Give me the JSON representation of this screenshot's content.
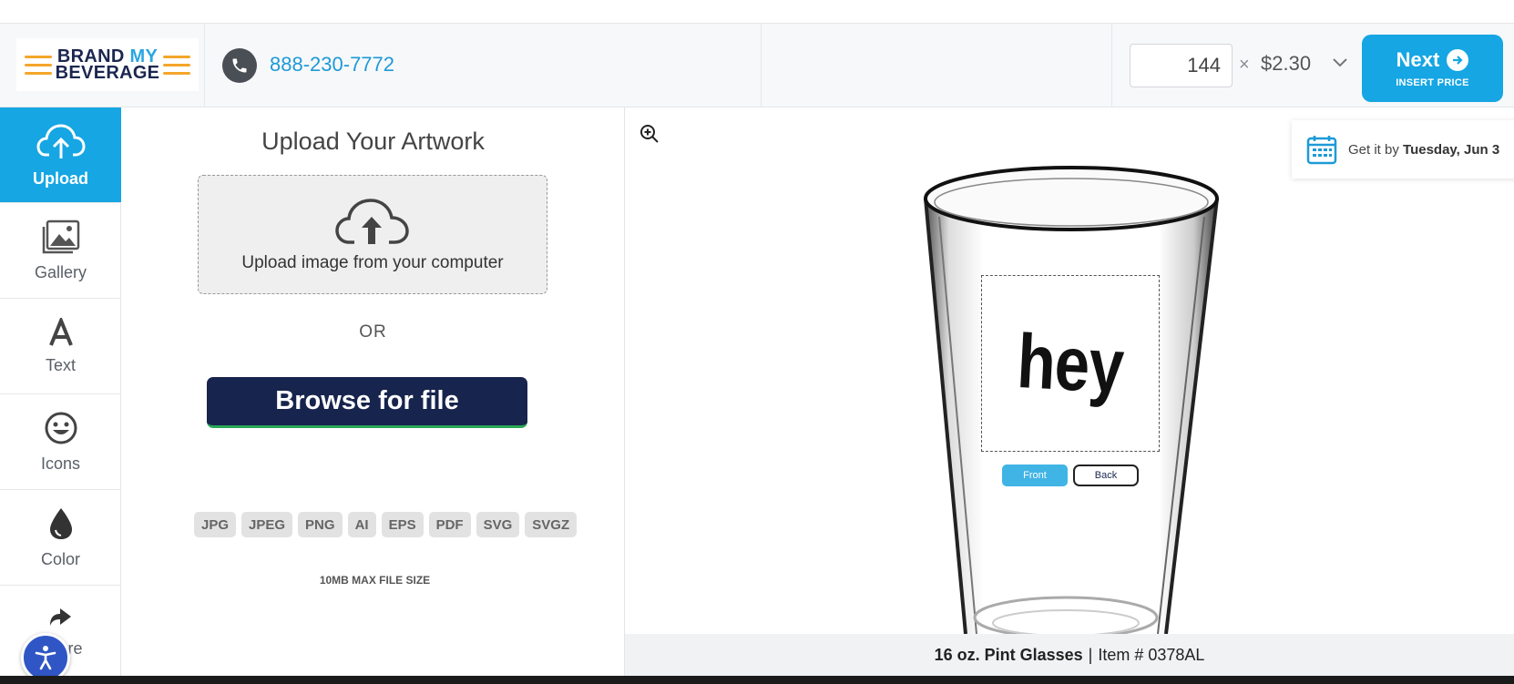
{
  "header": {
    "logo_line1": "BRAND",
    "logo_line1_accent": "MY",
    "logo_line2": "BEVERAGE",
    "phone": "888-230-7772",
    "quantity": "144",
    "times": "×",
    "unit_price": "$2.30",
    "next_label": "Next",
    "next_sub": "INSERT PRICE"
  },
  "sidebar": {
    "items": [
      {
        "label": "Upload",
        "icon": "cloud-upload-icon",
        "active": true
      },
      {
        "label": "Gallery",
        "icon": "gallery-icon"
      },
      {
        "label": "Text",
        "icon": "text-icon"
      },
      {
        "label": "Icons",
        "icon": "smiley-icon"
      },
      {
        "label": "Color",
        "icon": "droplet-icon"
      },
      {
        "label": "Share",
        "icon": "share-icon"
      }
    ]
  },
  "upload": {
    "title": "Upload Your Artwork",
    "drop_label": "Upload image from your computer",
    "or_text": "OR",
    "browse_label": "Browse for file",
    "formats": [
      "JPG",
      "JPEG",
      "PNG",
      "AI",
      "EPS",
      "PDF",
      "SVG",
      "SVGZ"
    ],
    "max_size": "10MB MAX FILE SIZE"
  },
  "preview": {
    "delivery_prefix": "Get it by",
    "delivery_date": "Tuesday, Jun 3",
    "print_text": "hey",
    "front_label": "Front",
    "back_label": "Back",
    "product_name": "16 oz. Pint Glasses",
    "item_sep": "|",
    "item_number": "Item # 0378AL"
  },
  "colors": {
    "accent": "#15a6e3",
    "navy": "#17244d",
    "logo_orange": "#f4a62a"
  }
}
